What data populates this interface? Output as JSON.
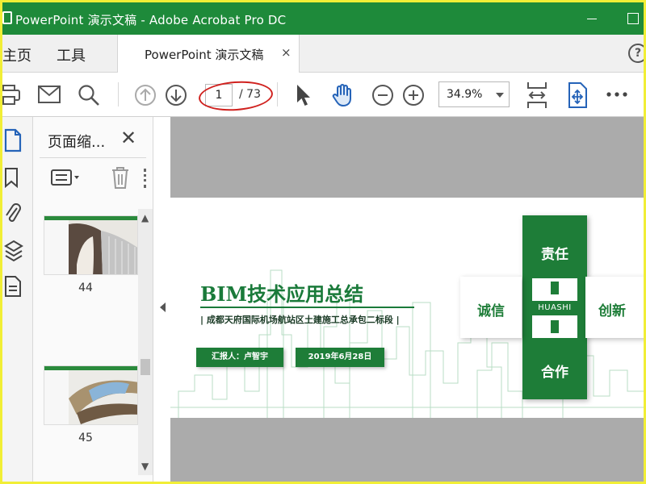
{
  "window": {
    "title": "PowerPoint 演示文稿 - Adobe Acrobat Pro DC"
  },
  "tabs": {
    "home_label": "主页",
    "tools_label": "工具",
    "document_tab_label": "PowerPoint 演示文稿",
    "close_glyph": "×",
    "help_glyph": "?"
  },
  "toolbar": {
    "current_page": "1",
    "total_pages": "/ 73",
    "zoom": "34.9%"
  },
  "panel": {
    "title": "页面缩...",
    "close_glyph": "✕",
    "thumbnails": [
      {
        "page": "44"
      },
      {
        "page": "45"
      }
    ]
  },
  "slide": {
    "title": "BIM技术应用总结",
    "subtitle": "| 成都天府国际机场航站区土建施工总承包二标段 |",
    "reporter": "汇报人：卢智宇",
    "date": "2019年6月28日",
    "cross": {
      "top": "责任",
      "left": "诚信",
      "right": "创新",
      "bottom": "合作",
      "brand": "HUASHI"
    }
  },
  "colors": {
    "title_bar": "#1e8a3a",
    "slide_green": "#1e7d38",
    "annotation_red": "#d0221f",
    "viewport_gray": "#ababab",
    "frame_yellow": "#f1ee36"
  },
  "icons": {
    "rail": [
      "page-thumbnails-icon",
      "bookmark-icon",
      "attachment-icon",
      "layers-icon",
      "document-properties-icon"
    ],
    "toolbar": [
      "print-icon",
      "email-icon",
      "search-icon",
      "previous-page-icon",
      "next-page-icon",
      "select-pointer-icon",
      "hand-tool-icon",
      "zoom-out-icon",
      "zoom-in-icon",
      "fit-page-icon",
      "scroll-mode-icon",
      "more-icon"
    ]
  }
}
